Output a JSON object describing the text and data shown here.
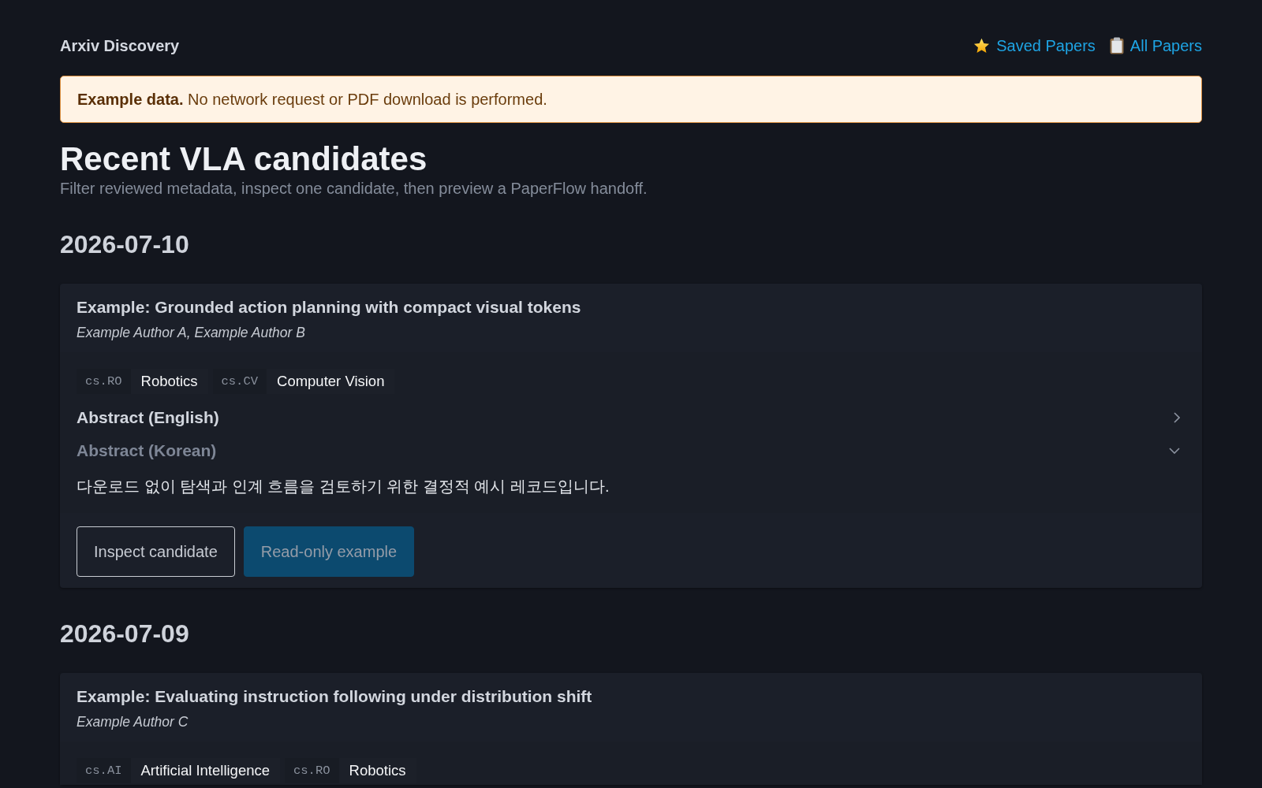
{
  "header": {
    "title": "Arxiv Discovery",
    "links": [
      {
        "kind": "star",
        "label": "Saved Papers"
      },
      {
        "kind": "clipboard",
        "label": "All Papers"
      }
    ]
  },
  "notice": {
    "text": "**Example data.** No network request or PDF download is performed."
  },
  "page": {
    "title": "Recent VLA candidates",
    "subtitle": "Filter reviewed metadata, inspect one candidate, then preview a PaperFlow handoff."
  },
  "groups": [
    {
      "date": "2026-07-10",
      "papers": [
        {
          "title": "Example: Grounded action planning with compact visual tokens",
          "authors": "Example Author A, Example Author B",
          "categories": [
            {
              "code": "cs.RO",
              "name": "Robotics"
            },
            {
              "code": "cs.CV",
              "name": "Computer Vision"
            }
          ],
          "sections": [
            {
              "title": "Abstract (English)",
              "expanded": false
            },
            {
              "title": "Abstract (Korean)",
              "expanded": true,
              "text": "다운로드 없이 탐색과 인계 흐름을 검토하기 위한 결정적 예시 레코드입니다."
            }
          ],
          "actions": [
            {
              "kind": "outline",
              "label": "Inspect candidate",
              "disabled": false
            },
            {
              "kind": "primary",
              "label": "Read-only example",
              "disabled": true
            }
          ]
        }
      ]
    },
    {
      "date": "2026-07-09",
      "papers": [
        {
          "title": "Example: Evaluating instruction following under distribution shift",
          "authors": "Example Author C",
          "categories": [
            {
              "code": "cs.AI",
              "name": "Artificial Intelligence"
            },
            {
              "code": "cs.RO",
              "name": "Robotics"
            }
          ]
        }
      ]
    }
  ]
}
